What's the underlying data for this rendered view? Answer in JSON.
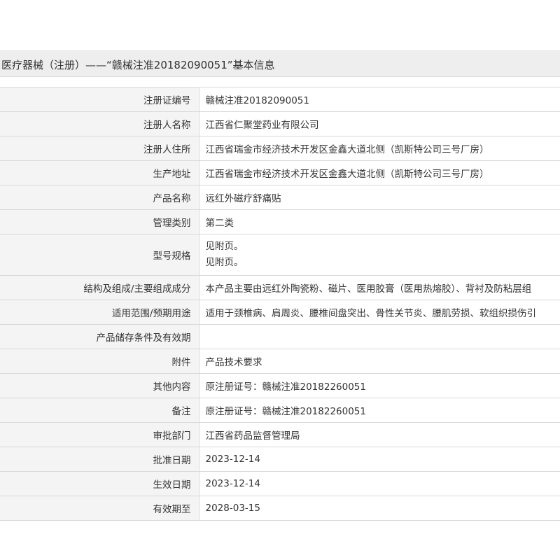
{
  "header": {
    "title": "医疗器械（注册）——“赣械注准20182090051”基本信息"
  },
  "rows": [
    {
      "label": "注册证编号",
      "value": "赣械注准20182090051"
    },
    {
      "label": "注册人名称",
      "value": "江西省仁聚堂药业有限公司"
    },
    {
      "label": "注册人住所",
      "value": "江西省瑞金市经济技术开发区金鑫大道北侧（凯斯特公司三号厂房）"
    },
    {
      "label": "生产地址",
      "value": "江西省瑞金市经济技术开发区金鑫大道北侧（凯斯特公司三号厂房）"
    },
    {
      "label": "产品名称",
      "value": "远红外磁疗舒痛贴"
    },
    {
      "label": "管理类别",
      "value": "第二类"
    },
    {
      "label": "型号规格",
      "value": "见附页。",
      "value2": "见附页。"
    },
    {
      "label": "结构及组成/主要组成成分",
      "value": "本产品主要由远红外陶瓷粉、磁片、医用胶膏（医用热熔胶）、背衬及防粘层组"
    },
    {
      "label": "适用范围/预期用途",
      "value": "适用于颈椎病、肩周炎、腰椎间盘突出、骨性关节炎、腰肌劳损、软组织损伤引"
    },
    {
      "label": "产品储存条件及有效期",
      "value": ""
    },
    {
      "label": "附件",
      "value": "产品技术要求"
    },
    {
      "label": "其他内容",
      "value": "原注册证号：赣械注准20182260051"
    },
    {
      "label": "备注",
      "value": "原注册证号：赣械注准20182260051"
    },
    {
      "label": "审批部门",
      "value": "江西省药品监督管理局"
    },
    {
      "label": "批准日期",
      "value": "2023-12-14"
    },
    {
      "label": "生效日期",
      "value": "2023-12-14"
    },
    {
      "label": "有效期至",
      "value": "2028-03-15"
    }
  ]
}
